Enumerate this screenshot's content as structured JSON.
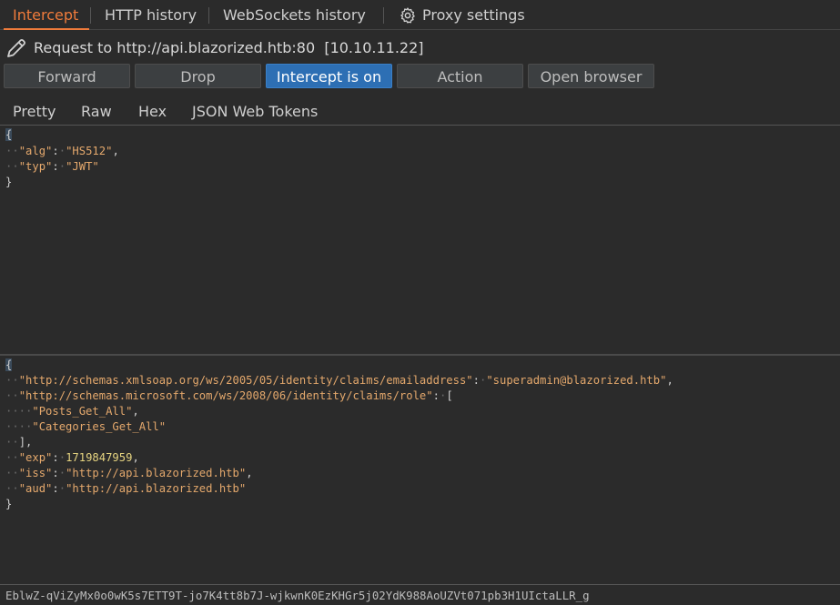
{
  "tabs": {
    "intercept": "Intercept",
    "http_history": "HTTP history",
    "websockets_history": "WebSockets history",
    "proxy_settings": "Proxy settings"
  },
  "request": {
    "label": "Request to http://api.blazorized.htb:80",
    "ip": "[10.10.11.22]"
  },
  "buttons": {
    "forward": "Forward",
    "drop": "Drop",
    "intercept": "Intercept is on",
    "action": "Action",
    "open_browser": "Open browser"
  },
  "subtabs": {
    "pretty": "Pretty",
    "raw": "Raw",
    "hex": "Hex",
    "jwt": "JSON Web Tokens"
  },
  "jwt_header": {
    "alg_key": "\"alg\"",
    "alg_val": "\"HS512\"",
    "typ_key": "\"typ\"",
    "typ_val": "\"JWT\""
  },
  "jwt_payload": {
    "email_key": "\"http://schemas.xmlsoap.org/ws/2005/05/identity/claims/emailaddress\"",
    "email_val": "\"superadmin@blazorized.htb\"",
    "role_key": "\"http://schemas.microsoft.com/ws/2008/06/identity/claims/role\"",
    "role_1": "\"Posts_Get_All\"",
    "role_2": "\"Categories_Get_All\"",
    "exp_key": "\"exp\"",
    "exp_val": "1719847959",
    "iss_key": "\"iss\"",
    "iss_val": "\"http://api.blazorized.htb\"",
    "aud_key": "\"aud\"",
    "aud_val": "\"http://api.blazorized.htb\""
  },
  "signature": "EblwZ-qViZyMx0o0wK5s7ETT9T-jo7K4tt8b7J-wjkwnK0EzKHGr5j02YdK988AoUZVt071pb3H1UIctaLLR_g",
  "colors": {
    "accent": "#ef7b3b",
    "primary_button": "#2d6fb4"
  }
}
